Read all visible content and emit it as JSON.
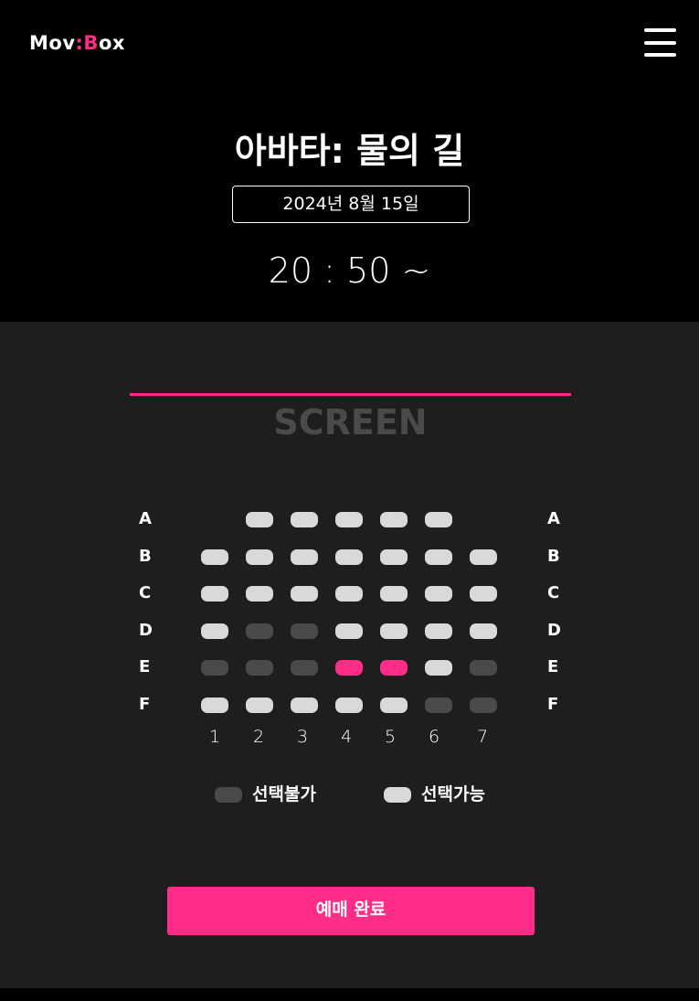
{
  "header": {
    "logo_part1": "Mov",
    "logo_colon": ":",
    "logo_part2": "B",
    "logo_part3": "ox",
    "menu_icon": "hamburger-menu-icon"
  },
  "movie": {
    "title": "아바타: 물의 길",
    "date": "2024년 8월 15일",
    "time": "20 : 50 ~"
  },
  "screen": {
    "label": "SCREEN"
  },
  "seatmap": {
    "rows": [
      "A",
      "B",
      "C",
      "D",
      "E",
      "F"
    ],
    "columns": [
      "1",
      "2",
      "3",
      "4",
      "5",
      "6",
      "7"
    ],
    "seats": {
      "A": [
        "none",
        "available",
        "available",
        "available",
        "available",
        "available",
        "none"
      ],
      "B": [
        "available",
        "available",
        "available",
        "available",
        "available",
        "available",
        "available"
      ],
      "C": [
        "available",
        "available",
        "available",
        "available",
        "available",
        "available",
        "available"
      ],
      "D": [
        "available",
        "unavailable",
        "unavailable",
        "available",
        "available",
        "available",
        "available"
      ],
      "E": [
        "unavailable",
        "unavailable",
        "unavailable",
        "selected",
        "selected",
        "available",
        "unavailable"
      ],
      "F": [
        "available",
        "available",
        "available",
        "available",
        "available",
        "unavailable",
        "unavailable"
      ]
    }
  },
  "legend": {
    "unavailable_label": "선택불가",
    "available_label": "선택가능"
  },
  "actions": {
    "book_label": "예매 완료"
  },
  "colors": {
    "accent": "#ff2d87",
    "available": "#d9d9d9",
    "unavailable": "#4a4a4a",
    "panel_bg": "#1e1e1e"
  }
}
